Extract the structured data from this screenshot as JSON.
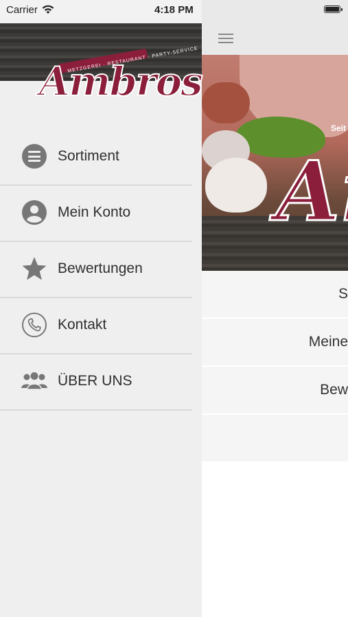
{
  "status_bar": {
    "carrier": "Carrier",
    "time": "4:18 PM"
  },
  "drawer": {
    "logo": {
      "name": "Ambros",
      "tagline": "METZGEREI · RESTAURANT · PARTY-SERVICE"
    },
    "items": [
      {
        "label": "Sortiment",
        "icon": "list-icon"
      },
      {
        "label": "Mein Konto",
        "icon": "user-icon"
      },
      {
        "label": "Bewertungen",
        "icon": "star-icon"
      },
      {
        "label": "Kontakt",
        "icon": "phone-icon"
      },
      {
        "label": "ÜBER UNS",
        "icon": "group-icon"
      }
    ]
  },
  "main": {
    "hero": {
      "logo_text": "Am",
      "tag": "Seit"
    },
    "menu": [
      {
        "label": "S"
      },
      {
        "label": "Meine"
      },
      {
        "label": "Bew"
      }
    ]
  },
  "colors": {
    "brand": "#8b1e3a",
    "icon_gray": "#777777",
    "drawer_bg": "#efefef"
  }
}
